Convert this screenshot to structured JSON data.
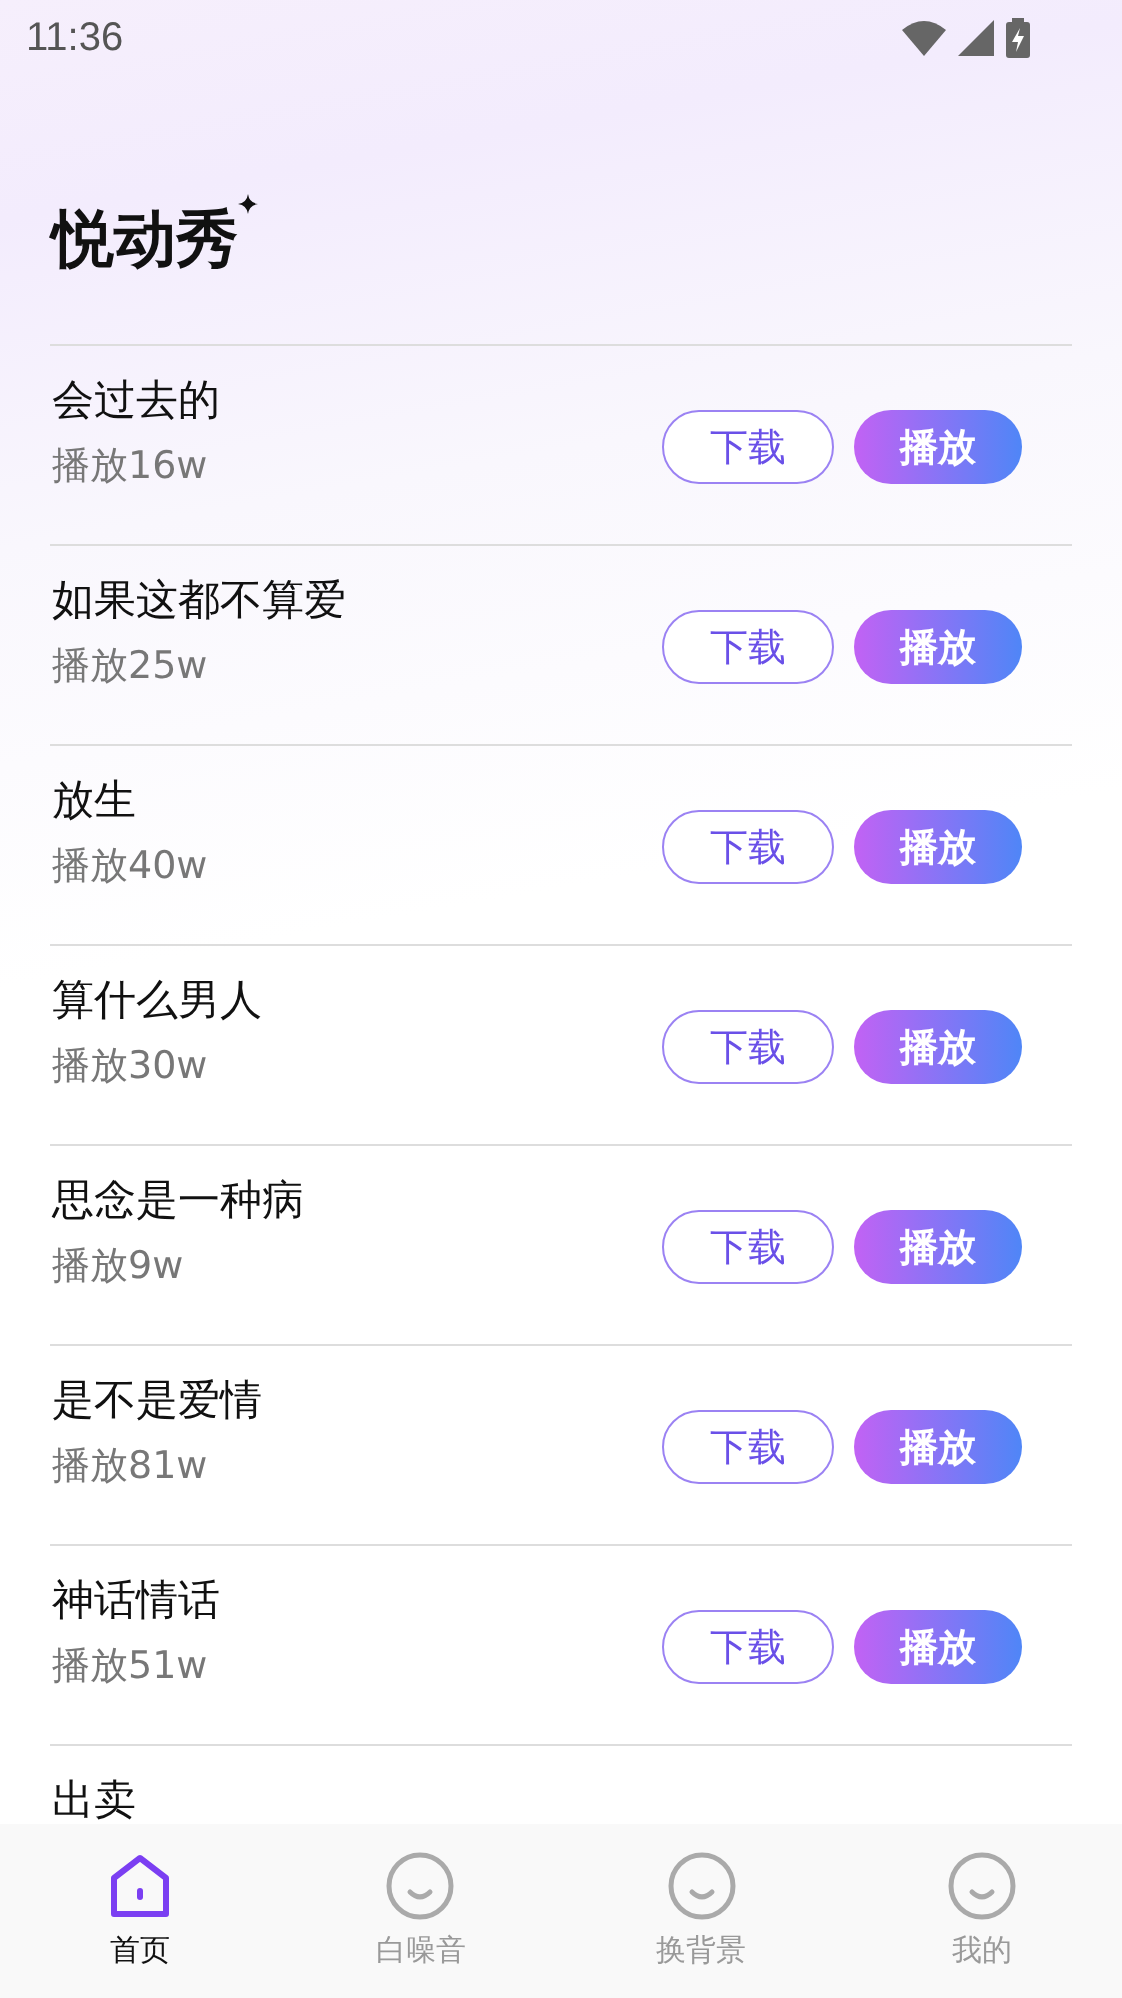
{
  "status_bar": {
    "time": "11:36"
  },
  "app_title": "悦动秀",
  "songs": [
    {
      "title": "会过去的",
      "plays": "播放16w",
      "download": "下载",
      "play": "播放"
    },
    {
      "title": "如果这都不算爱",
      "plays": "播放25w",
      "download": "下载",
      "play": "播放"
    },
    {
      "title": "放生",
      "plays": "播放40w",
      "download": "下载",
      "play": "播放"
    },
    {
      "title": "算什么男人",
      "plays": "播放30w",
      "download": "下载",
      "play": "播放"
    },
    {
      "title": "思念是一种病",
      "plays": "播放9w",
      "download": "下载",
      "play": "播放"
    },
    {
      "title": "是不是爱情",
      "plays": "播放81w",
      "download": "下载",
      "play": "播放"
    },
    {
      "title": "神话情话",
      "plays": "播放51w",
      "download": "下载",
      "play": "播放"
    },
    {
      "title": "出卖"
    }
  ],
  "bottom_nav": [
    {
      "label": "首页",
      "kind": "home",
      "selected": true
    },
    {
      "label": "白噪音",
      "kind": "face",
      "selected": false
    },
    {
      "label": "换背景",
      "kind": "face",
      "selected": false
    },
    {
      "label": "我的",
      "kind": "face",
      "selected": false
    }
  ]
}
